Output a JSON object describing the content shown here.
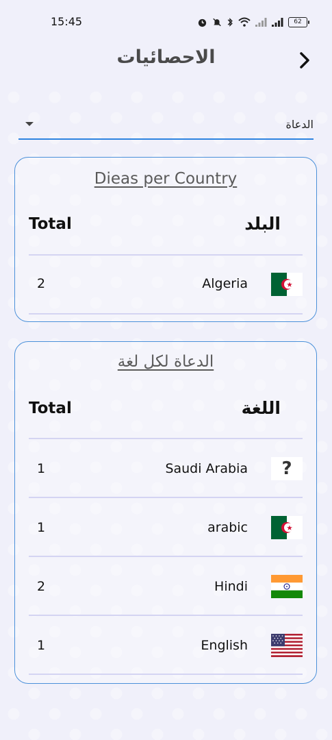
{
  "status_bar": {
    "time": "15:45",
    "battery": "62",
    "icons": [
      "alarm-icon",
      "mute-icon",
      "bluetooth-icon",
      "wifi-icon",
      "signal-icon",
      "signal-icon",
      "battery-icon"
    ]
  },
  "header": {
    "title": "الاحصائيات",
    "back_icon": "chevron-right-icon"
  },
  "filter": {
    "selected": "الدعاة"
  },
  "country_card": {
    "title": "Dieas per Country",
    "col_total": "Total",
    "col_name": "البلد",
    "rows": [
      {
        "total": "2",
        "name": "Algeria",
        "flag": "algeria-flag"
      }
    ]
  },
  "language_card": {
    "title": "الدعاة لكل لغة",
    "col_total": "Total",
    "col_name": "اللغة",
    "rows": [
      {
        "total": "1",
        "name": "Saudi Arabia",
        "flag": "unknown-flag",
        "flag_text": "?"
      },
      {
        "total": "1",
        "name": "arabic",
        "flag": "algeria-flag"
      },
      {
        "total": "2",
        "name": "Hindi",
        "flag": "india-flag"
      },
      {
        "total": "1",
        "name": "English",
        "flag": "usa-flag"
      }
    ]
  },
  "colors": {
    "accent": "#2d83e0",
    "card_border": "#4a90d9",
    "divider": "#d4d4f2",
    "background": "#f0f0fa"
  }
}
